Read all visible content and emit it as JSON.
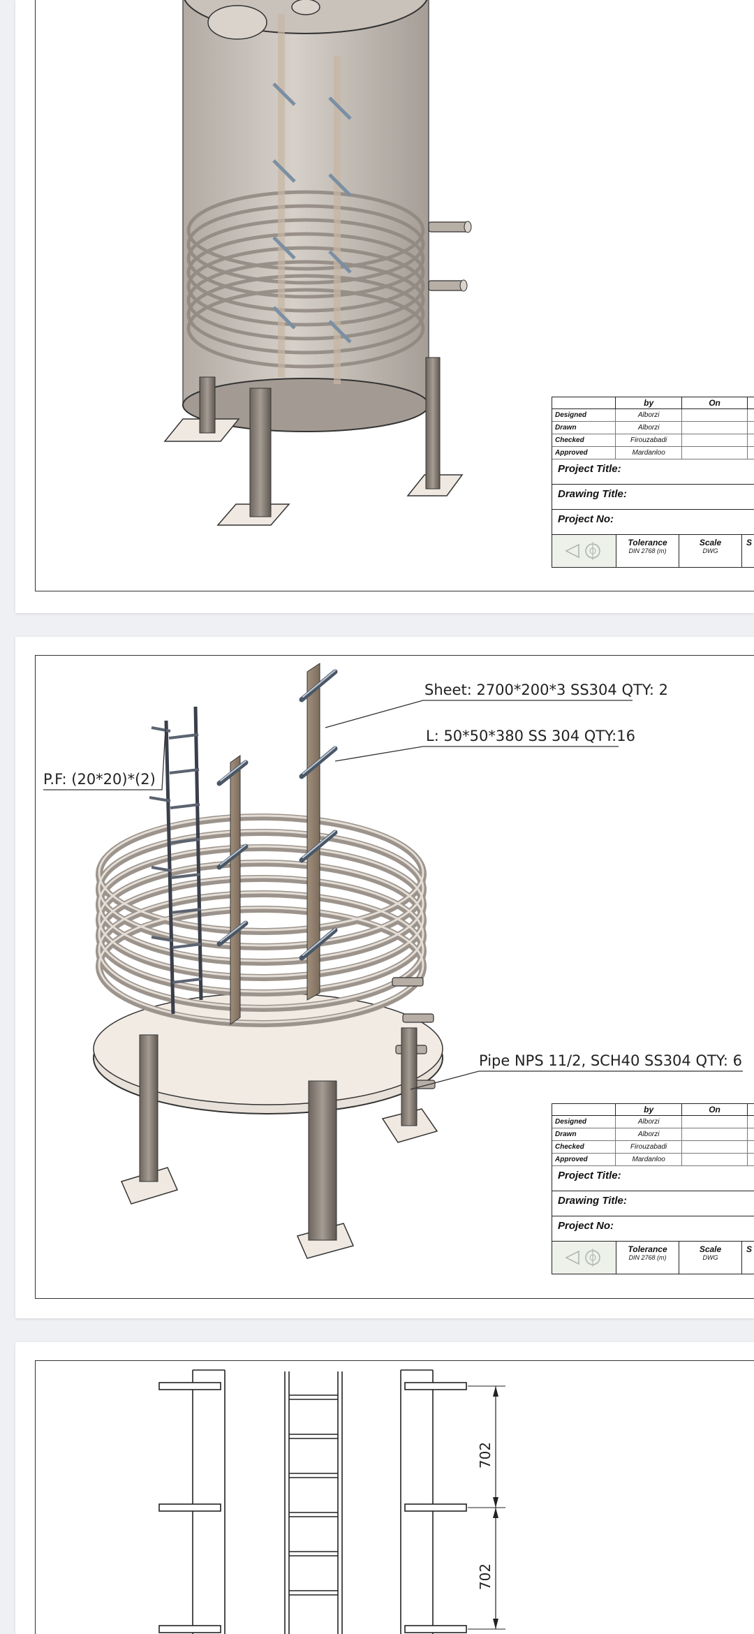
{
  "title_block": {
    "header": {
      "col_by": "by",
      "col_on": "On"
    },
    "rows": [
      {
        "role": "Designed",
        "by": "Alborzi"
      },
      {
        "role": "Drawn",
        "by": "Alborzi"
      },
      {
        "role": "Checked",
        "by": "Firouzabadi"
      },
      {
        "role": "Approved",
        "by": "Mardanloo"
      }
    ],
    "project_title_label": "Project Title:",
    "drawing_title_label": "Drawing Title:",
    "project_no_label": "Project No:",
    "tolerance_label": "Tolerance",
    "tolerance_value": "DIN 2768 (m)",
    "scale_label": "Scale",
    "scale_value": "DWG",
    "cut_label": "S"
  },
  "sheet2": {
    "callout_sheet": "Sheet: 2700*200*3 SS304 QTY: 2",
    "callout_angle": "L: 50*50*380 SS 304 QTY:16",
    "callout_pf": "P.F: (20*20)*(2)",
    "callout_pipe": "Pipe NPS 11/2, SCH40 SS304 QTY: 6"
  },
  "sheet3": {
    "dim_upper": "702",
    "dim_lower": "702"
  },
  "colors": {
    "accent_line": "#333333",
    "steel": "#bcb3ab",
    "post": "#8a7e74",
    "page_bg": "#eef0f3"
  }
}
